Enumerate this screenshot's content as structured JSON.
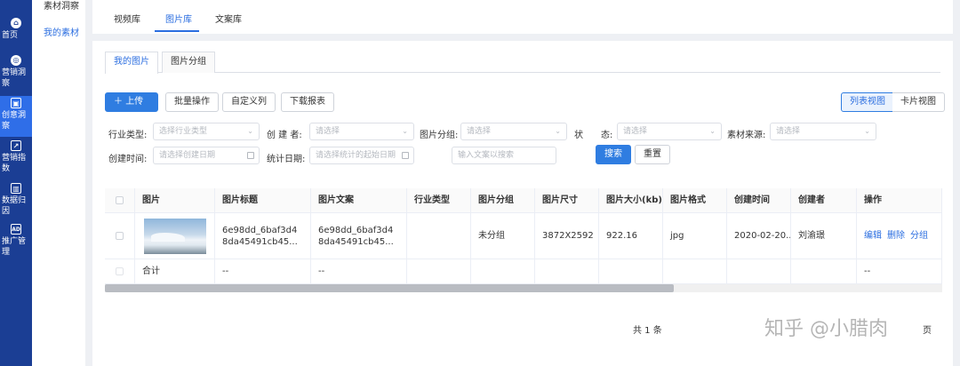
{
  "rail": [
    {
      "label": "首页",
      "icon": "home-icon",
      "glyph": "⌂"
    },
    {
      "label": "营销洞察",
      "icon": "insight-icon",
      "glyph": "◎"
    },
    {
      "label": "创意洞察",
      "icon": "image-icon",
      "glyph": "▣"
    },
    {
      "label": "营销指数",
      "icon": "trend-icon",
      "glyph": "↗"
    },
    {
      "label": "数据归因",
      "icon": "bar-chart-icon",
      "glyph": "▥"
    },
    {
      "label": "推广管理",
      "icon": "ad-icon",
      "glyph": "AD"
    }
  ],
  "subnav": {
    "item1": "素材洞察",
    "item2": "我的素材"
  },
  "top_tabs": [
    "视频库",
    "图片库",
    "文案库"
  ],
  "sub_tabs": [
    "我的图片",
    "图片分组"
  ],
  "toolbar": {
    "upload": "上传",
    "batch": "批量操作",
    "custom_cols": "自定义列",
    "download": "下载报表",
    "list_view": "列表视图",
    "card_view": "卡片视图"
  },
  "filters": {
    "industry_label": "行业类型:",
    "industry_ph": "选择行业类型",
    "creator_label": "创 建 者:",
    "creator_ph": "请选择",
    "group_label": "图片分组:",
    "group_ph": "请选择",
    "status_label": "状",
    "status_label2": "态:",
    "status_ph": "请选择",
    "source_label": "素材来源:",
    "source_ph": "请选择",
    "created_label": "创建时间:",
    "created_ph": "请选择创建日期",
    "stat_label": "统计日期:",
    "stat_ph": "请选择统计的起始日期",
    "search_ph": "输入文案以搜索",
    "search_btn": "搜索",
    "reset_btn": "重置"
  },
  "table": {
    "headers": [
      "图片",
      "图片标题",
      "图片文案",
      "行业类型",
      "图片分组",
      "图片尺寸",
      "图片大小(kb)",
      "图片格式",
      "创建时间",
      "创建者",
      "操作"
    ],
    "row": {
      "title": "6e98dd_6baf3d48da45491cb45...",
      "copy": "6e98dd_6baf3d48da45491cb45...",
      "industry": "",
      "group": "未分组",
      "size": "3872X2592",
      "kb": "922.16",
      "format": "jpg",
      "created": "2020-02-20...",
      "creator": "刘渝璟",
      "ops": [
        "编辑",
        "删除",
        "分组"
      ]
    },
    "total": {
      "label": "合计",
      "title": "--",
      "copy": "--",
      "ops": "--"
    }
  },
  "pager": {
    "total": "共 1 条",
    "page": "页"
  },
  "watermark": "知乎 @小腊肉"
}
